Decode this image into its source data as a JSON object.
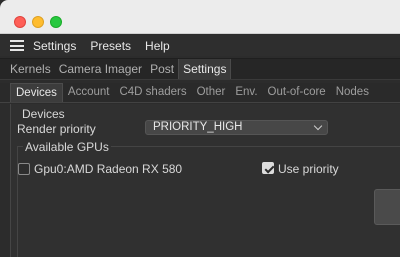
{
  "menubar": {
    "items": [
      "Settings",
      "Presets",
      "Help"
    ]
  },
  "main_tabs": [
    {
      "label": "Kernels",
      "active": false
    },
    {
      "label": "Camera Imager",
      "active": false
    },
    {
      "label": "Post",
      "active": false
    },
    {
      "label": "Settings",
      "active": true
    }
  ],
  "sub_tabs": [
    {
      "label": "Devices",
      "active": true
    },
    {
      "label": "Account",
      "active": false
    },
    {
      "label": "C4D shaders",
      "active": false
    },
    {
      "label": "Other",
      "active": false
    },
    {
      "label": "Env.",
      "active": false
    },
    {
      "label": "Out-of-core",
      "active": false
    },
    {
      "label": "Nodes",
      "active": false
    }
  ],
  "devices": {
    "section_label": "Devices",
    "render_priority_label": "Render priority",
    "render_priority_value": "PRIORITY_HIGH",
    "available_gpus_label": "Available GPUs",
    "gpu": {
      "name": "Gpu0:AMD Radeon RX 580",
      "enabled": false,
      "use_priority_label": "Use priority",
      "use_priority": true
    }
  }
}
